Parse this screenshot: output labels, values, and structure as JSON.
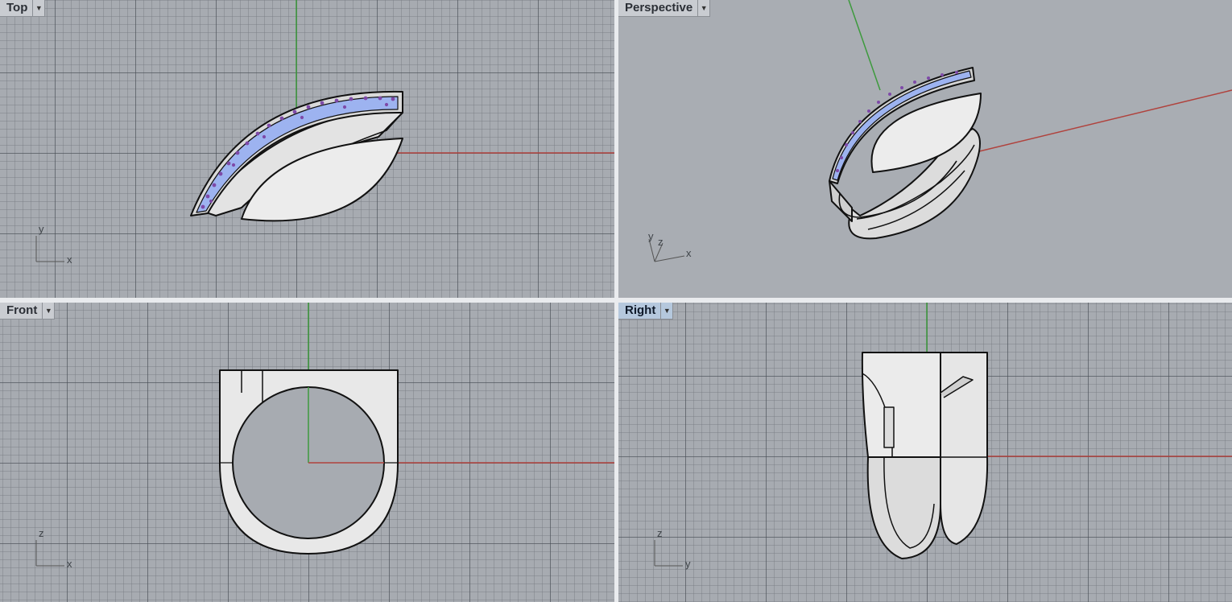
{
  "viewports": {
    "top": {
      "label": "Top",
      "axes": {
        "h": "x",
        "v": "y"
      }
    },
    "perspective": {
      "label": "Perspective",
      "axes": {
        "h": "x",
        "v": "y",
        "d": "z"
      }
    },
    "front": {
      "label": "Front",
      "axes": {
        "h": "x",
        "v": "z"
      }
    },
    "right": {
      "label": "Right",
      "axes": {
        "h": "y",
        "v": "z"
      },
      "active": true
    }
  },
  "icons": {
    "viewport_menu": "chevron-down-icon"
  },
  "colors": {
    "viewport_bg": "#a7abb1",
    "active_tab_bg": "#b5c8dd",
    "x_axis": "#b0423d",
    "y_axis": "#3d9a3d",
    "gem_fill": "#9db3f0",
    "gem_dot": "#7e4aa8",
    "metal": "#ececec"
  }
}
